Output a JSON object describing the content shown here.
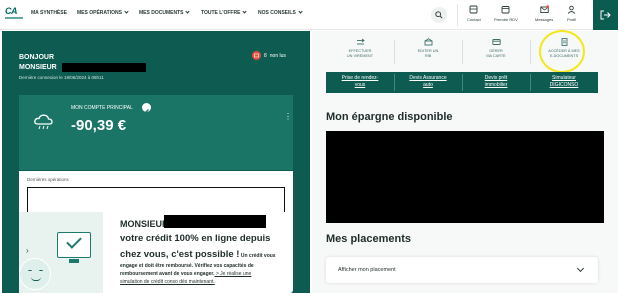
{
  "nav": {
    "logo_text": "CA",
    "menu": [
      {
        "label": "MA SYNTHÈSE",
        "has_chevron": false
      },
      {
        "label": "MES OPÉRATIONS",
        "has_chevron": true
      },
      {
        "label": "MES DOCUMENTS",
        "has_chevron": true
      },
      {
        "label": "TOUTE L'OFFRE",
        "has_chevron": true
      },
      {
        "label": "NOS CONSEILS",
        "has_chevron": true
      }
    ],
    "tools": {
      "contact": "Contact",
      "rdv": "Prendre RDV",
      "messages": "Messages",
      "profil": "Profil"
    }
  },
  "greeting": {
    "line1": "BONJOUR",
    "line2": "MONSIEUR",
    "last_connection": "Dernière connexion le 19/06/2024 à 06h11",
    "unread_count": "8",
    "unread_label": "non lus"
  },
  "account": {
    "name": "MON COMPTE PRINCIPAL",
    "balance": "-90,39 €",
    "ops_title": "Dernières opérations"
  },
  "promo": {
    "title": "MONSIEUR",
    "line1": "votre crédit 100% en ligne depuis",
    "line2_bold": "chez vous, c'est possible !",
    "line2_small": " Un crédit vous",
    "line3": "engage et doit être remboursé. Vérifiez vos capacités de",
    "line4": "remboursement avant de vous engager.",
    "line4_link": " > Je réalise une",
    "line5": "simulation de crédit conso dès maintenant."
  },
  "quick_actions": [
    {
      "label1": "EFFECTUER",
      "label2": "UN VIREMENT",
      "icon": "transfer-icon"
    },
    {
      "label1": "EDITER UN",
      "label2": "RIB",
      "icon": "rib-icon"
    },
    {
      "label1": "GÉRER",
      "label2": "MA CARTE",
      "icon": "card-icon"
    },
    {
      "label1": "ACCÉDER À MES",
      "label2": "E-DOCUMENTS",
      "icon": "document-icon"
    }
  ],
  "links": [
    {
      "l1": "Prise de rendez-",
      "l2": "vous"
    },
    {
      "l1": "Devis Assurance",
      "l2": "auto"
    },
    {
      "l1": "Devis prêt",
      "l2": "immobilier"
    },
    {
      "l1": "Simulateur",
      "l2": "DIGICONSO"
    }
  ],
  "savings": {
    "title": "Mon épargne disponible"
  },
  "placements": {
    "title": "Mes placements",
    "button": "Afficher mon placement"
  },
  "colors": {
    "primary": "#0e5c51",
    "account": "#1a7567",
    "highlight": "#f2e81d",
    "badge": "#e44b3d"
  }
}
